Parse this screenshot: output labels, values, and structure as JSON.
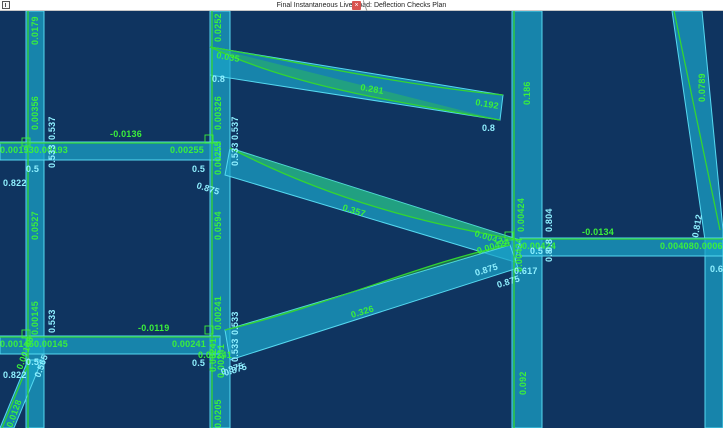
{
  "window": {
    "title": "Final Instantaneous Live Load: Deflection Checks Plan",
    "close_symbol": "×"
  },
  "colors": {
    "background": "#0f3460",
    "beam_fill": "#1aa3c8",
    "beam_edge": "#55d8f0",
    "deflection_line": "#33d433",
    "green_label": "#3bf03b",
    "cyan_label": "#8ff0ff"
  },
  "labels": {
    "green": [
      "0.0179",
      "0.0252",
      "0.035",
      "0.281",
      "0.192",
      "0.186",
      "0.0789",
      "0.00356",
      "0.00193",
      "0.00193",
      "-0.0136",
      "0.00255",
      "0.00326",
      "0.00255",
      "0.357",
      "0.0527",
      "0.0594",
      "0.00424",
      "-0.0134",
      "0.00424",
      "0.00424",
      "0.00408",
      "0.0006",
      "0.00424",
      "0.00424",
      "0.00145",
      "-0.0119",
      "0.00241",
      "0.00241",
      "0.326",
      "0.00145",
      "0.00145",
      "0.00145",
      "0.00241",
      "0.00241",
      "0.00241",
      "0.0128",
      "0.0205",
      "0.092"
    ],
    "cyan": [
      "0.537",
      "0.8",
      "0.8",
      "0.537",
      "0.822",
      "0.5",
      "0.5",
      "0.875",
      "0.533",
      "0.533",
      "0.5",
      "0.875",
      "0.875",
      "0.875",
      "0.617",
      "0.804",
      "0.8",
      "0.812",
      "0.6",
      "0.533",
      "0.533",
      "0.5",
      "0.822",
      "0.565",
      "0.875",
      "0.533",
      "0.5",
      "0.8"
    ]
  }
}
